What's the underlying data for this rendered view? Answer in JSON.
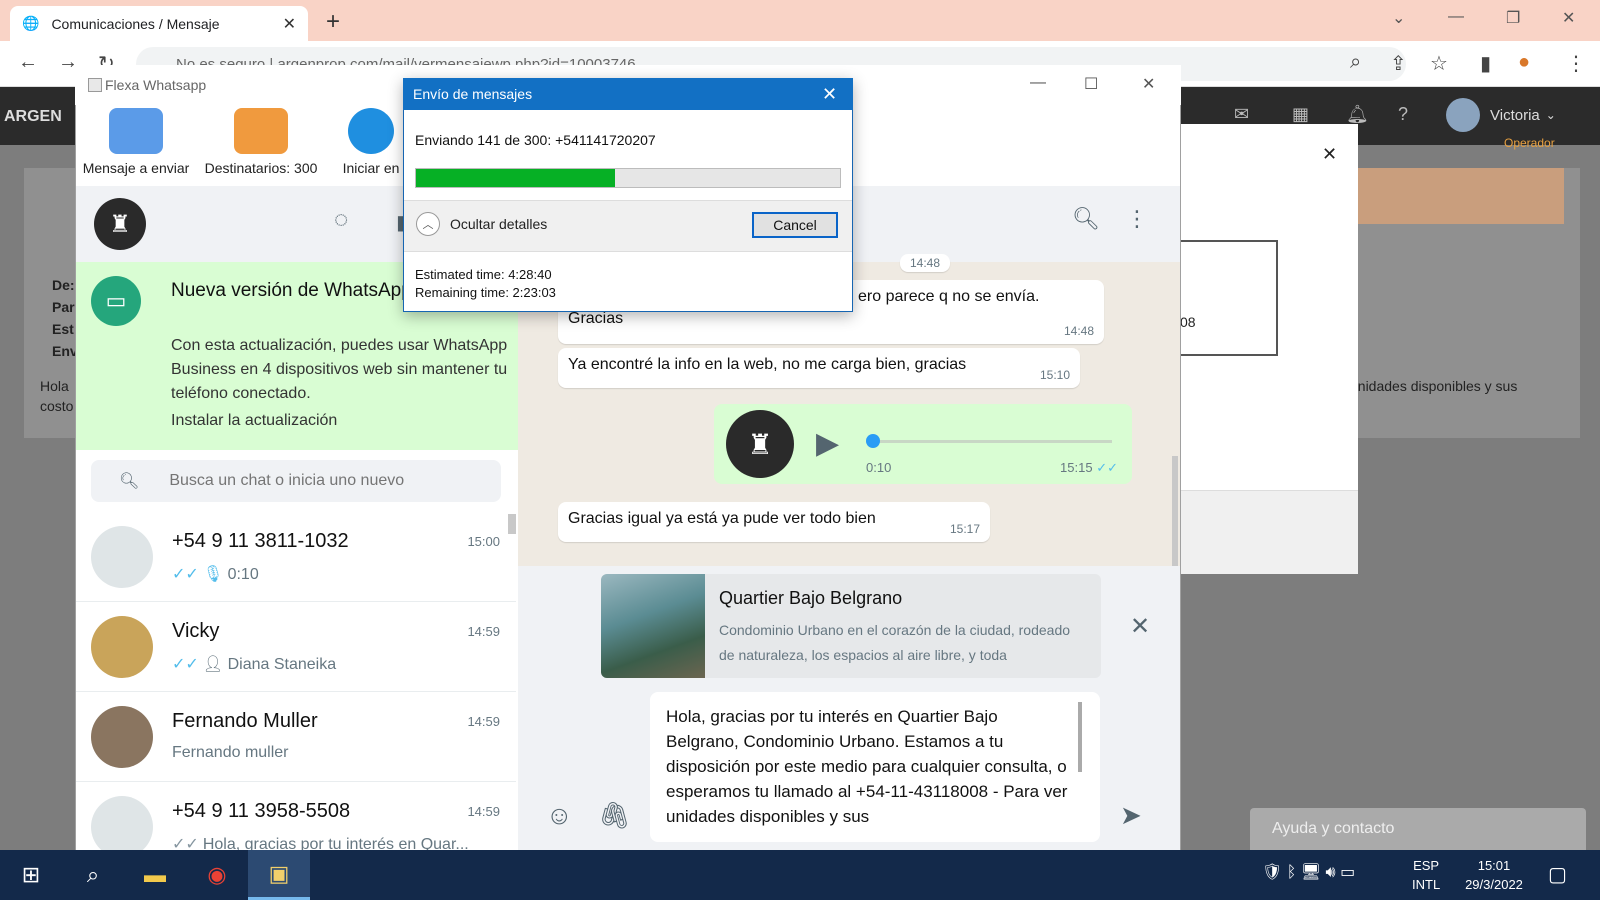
{
  "browser": {
    "tab_title": "Comunicaciones / Mensaje",
    "address": "No es seguro | argenprop.com/mail/vermensajewp.php?id=10003746"
  },
  "site": {
    "logo": "ARGEN",
    "user_name": "Victoria",
    "user_role": "Operador",
    "left_labels": [
      "De:",
      "Par",
      "Est",
      "Env"
    ],
    "left_stub": [
      "Hola",
      "costo"
    ],
    "right_text": "unidades disponibles y sus",
    "modal_text": "08",
    "help": "Ayuda y contacto"
  },
  "flexa": {
    "title": "Flexa Whatsapp",
    "ribbon": {
      "message": "Mensaje a enviar",
      "recipients": "Destinatarios: 300",
      "start": "Iniciar en"
    }
  },
  "dialog": {
    "title": "Envío de mensajes",
    "status": "Enviando 141 de 300: +541141720207",
    "progress": 0.47,
    "details_label": "Ocultar detalles",
    "cancel": "Cancel",
    "estimated": "Estimated time: 4:28:40",
    "remaining": "Remaining time: 2:23:03"
  },
  "whatsapp": {
    "banner": {
      "title": "Nueva versión de WhatsApp disponible",
      "body": "Con esta actualización, puedes usar WhatsApp Business en 4 dispositivos web sin mantener tu teléfono conectado.",
      "link": "Instalar la actualización"
    },
    "search_placeholder": "Busca un chat o inicia uno nuevo",
    "chats": [
      {
        "name": "+54 9 11 3811-1032",
        "time": "15:00",
        "preview": "0:10"
      },
      {
        "name": "Vicky",
        "time": "14:59",
        "preview": "Diana Staneika"
      },
      {
        "name": "Fernando Muller",
        "time": "14:59",
        "preview": "Fernando muller"
      },
      {
        "name": "+54 9 11 3958-5508",
        "time": "14:59",
        "preview": "Hola, gracias por tu interés en Quar..."
      }
    ],
    "messages": {
      "m0_time": "14:48",
      "m1_text": "ero parece q no se envía.",
      "m1b_text": "Gracias",
      "m1_time": "14:48",
      "m2_text": "Ya encontré la info en la web, no me carga bien, gracias",
      "m2_time": "15:10",
      "audio_duration": "0:10",
      "audio_time": "15:15",
      "m3_text": "Gracias igual ya está ya pude ver todo bien",
      "m3_time": "15:17"
    },
    "preview": {
      "title": "Quartier Bajo Belgrano",
      "desc": "Condominio Urbano en el corazón de la ciudad, rodeado de naturaleza, los espacios al aire libre, y toda"
    },
    "compose": "Hola, gracias por tu interés en Quartier Bajo Belgrano, Condominio Urbano. Estamos a tu disposición por este medio para cualquier consulta, o esperamos tu llamado al +54-11-43118008  - Para ver unidades disponibles y sus"
  },
  "taskbar": {
    "lang1": "ESP",
    "lang2": "INTL",
    "time": "15:01",
    "date": "29/3/2022"
  },
  "colors": {
    "wa_green": "#25a67c",
    "progress": "#06b025",
    "dialog_title": "#1270c4",
    "tabbar": "#f9d3c6"
  }
}
